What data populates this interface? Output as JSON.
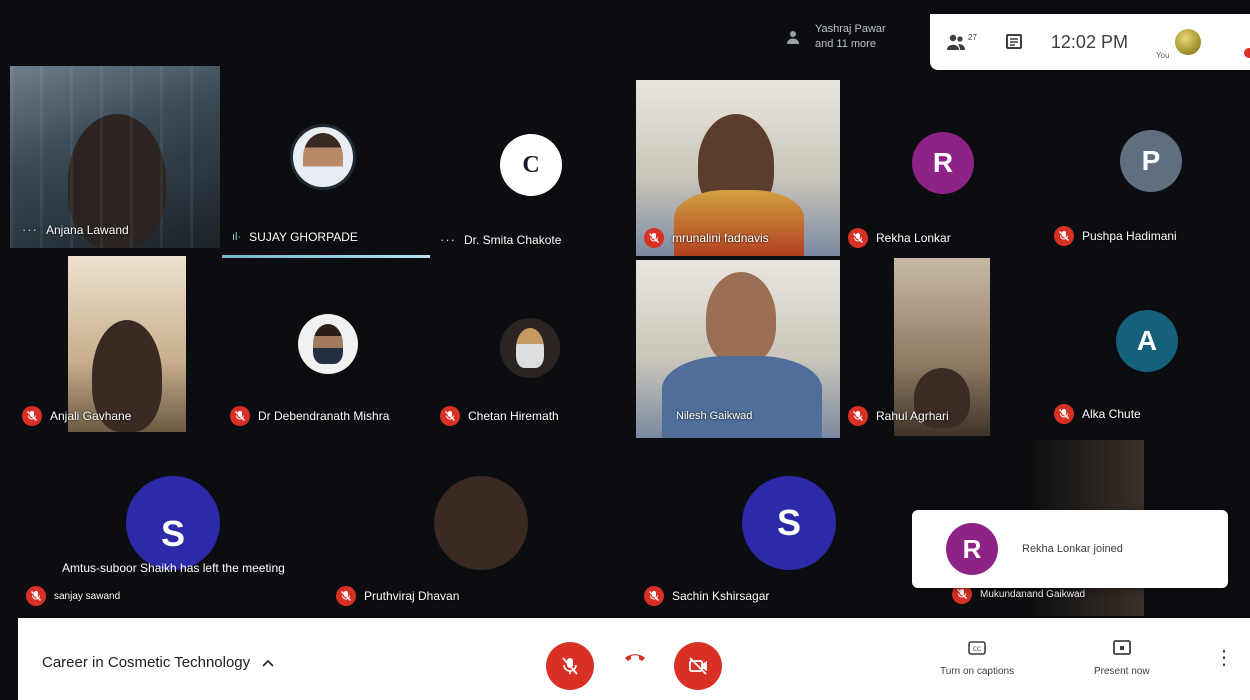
{
  "top": {
    "participants_chip": {
      "line1": "Yashraj Pawar",
      "line2": "and 11 more"
    },
    "people_count": "27",
    "clock": "12:02 PM",
    "you_label": "You"
  },
  "tiles": [
    {
      "name": "Anjana Lawand",
      "state": "video",
      "indicator": "dots"
    },
    {
      "name": "SUJAY GHORPADE",
      "state": "avatar-photo",
      "indicator": "speaking"
    },
    {
      "name": "Dr. Smita Chakote",
      "state": "avatar-logo",
      "indicator": "dots",
      "logo_text": "C"
    },
    {
      "name": "mrunalini fadnavis",
      "state": "video",
      "indicator": "mic-off"
    },
    {
      "name": "Rekha Lonkar",
      "state": "avatar",
      "letter": "R",
      "color": "#8d2386",
      "indicator": "mic-off"
    },
    {
      "name": "Pushpa Hadimani",
      "state": "avatar",
      "letter": "P",
      "color": "#5f6f7f",
      "indicator": "mic-off"
    },
    {
      "name": "Anjali Gavhane",
      "state": "video",
      "indicator": "mic-off"
    },
    {
      "name": "Dr Debendranath Mishra",
      "state": "avatar-photo",
      "indicator": "mic-off"
    },
    {
      "name": "Chetan Hiremath",
      "state": "avatar-photo",
      "indicator": "mic-off"
    },
    {
      "name": "Nilesh Gaikwad",
      "state": "video",
      "indicator": "none"
    },
    {
      "name": "Rahul Agrhari",
      "state": "video",
      "indicator": "mic-off"
    },
    {
      "name": "Alka Chute",
      "state": "avatar",
      "letter": "A",
      "color": "#15607a",
      "indicator": "mic-off"
    },
    {
      "name": "sanjay sawand",
      "state": "avatar",
      "letter": "S",
      "color": "#2c2aa8",
      "indicator": "mic-off"
    },
    {
      "name": "Pruthviraj Dhavan",
      "state": "avatar-photo",
      "indicator": "mic-off"
    },
    {
      "name": "Sachin Kshirsagar",
      "state": "avatar",
      "letter": "S",
      "color": "#2c2aa8",
      "indicator": "mic-off"
    },
    {
      "name": "Mukundanand Gaikwad",
      "state": "video",
      "indicator": "mic-off"
    }
  ],
  "notices": {
    "left_meeting": "Amtus-suboor Shaikh has left the meeting",
    "joined_toast": {
      "letter": "R",
      "text": "Rekha Lonkar joined",
      "color": "#8d2386"
    }
  },
  "bottom": {
    "meeting_title": "Career in Cosmetic Technology",
    "captions_label": "Turn on captions",
    "present_label": "Present now"
  }
}
